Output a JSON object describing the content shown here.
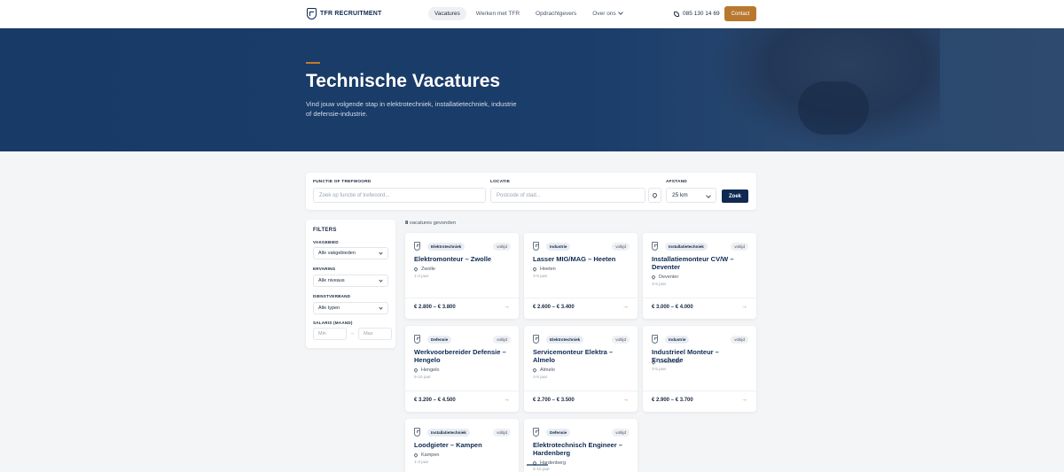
{
  "header": {
    "logo": "TFR RECRUITMENT",
    "nav": [
      {
        "label": "Vacatures",
        "active": true
      },
      {
        "label": "Werken met TFR",
        "active": false
      },
      {
        "label": "Opdrachtgevers",
        "active": false
      },
      {
        "label": "Over ons",
        "active": false
      }
    ],
    "phone": "085 130 14 69",
    "contact_label": "Contact"
  },
  "hero": {
    "title": "Technische Vacatures",
    "subtitle": "Vind jouw volgende stap in elektrotechniek, installatietechniek, industrie of defensie-industrie."
  },
  "search": {
    "keyword_label": "FUNCTIE OF TREFWOORD",
    "keyword_placeholder": "Zoek op functie of trefwoord...",
    "location_label": "LOCATIE",
    "location_placeholder": "Postcode of stad...",
    "distance_label": "AFSTAND",
    "distance_value": "25 km",
    "submit_label": "Zoek"
  },
  "filters": {
    "title": "FILTERS",
    "vakgebied_label": "VAKGEBIED",
    "vakgebied_value": "Alle vakgebieden",
    "ervaring_label": "ERVARING",
    "ervaring_value": "Alle niveaus",
    "dienstverband_label": "DIENSTVERBAND",
    "dienstverband_value": "Alle typen",
    "salaris_label": "SALARIS (MAAND)",
    "min_placeholder": "Min",
    "max_placeholder": "Max",
    "range_dash": "–"
  },
  "results": {
    "count": "8",
    "count_text": " vacatures gevonden"
  },
  "jobs": [
    {
      "tag": "Elektrotechniek",
      "type": "voltijd",
      "title": "Elektromonteur – Zwolle",
      "location": "Zwolle",
      "experience": "1-3 jaar",
      "salary": "€ 2.800 – € 3.800"
    },
    {
      "tag": "Industrie",
      "type": "voltijd",
      "title": "Lasser MIG/MAG – Heeten",
      "location": "Heeten",
      "experience": "3-5 jaar",
      "salary": "€ 2.600 – € 3.400"
    },
    {
      "tag": "Installatietechniek",
      "type": "voltijd",
      "title": "Installatiemonteur CV/W – Deventer",
      "location": "Deventer",
      "experience": "3-5 jaar",
      "salary": "€ 3.000 – € 4.000"
    },
    {
      "tag": "Defensie",
      "type": "voltijd",
      "title": "Werkvoorbereider Defensie – Hengelo",
      "location": "Hengelo",
      "experience": "5-10 jaar",
      "salary": "€ 3.200 – € 4.500"
    },
    {
      "tag": "Elektrotechniek",
      "type": "voltijd",
      "title": "Servicemonteur Elektra – Almelo",
      "location": "Almelo",
      "experience": "3-5 jaar",
      "salary": "€ 2.700 – € 3.500"
    },
    {
      "tag": "Industrie",
      "type": "voltijd",
      "title": "Industrieel Monteur – Enschede",
      "location": "Enschede",
      "experience": "3-5 jaar",
      "salary": "€ 2.900 – € 3.700"
    },
    {
      "tag": "Installatietechniek",
      "type": "voltijd",
      "title": "Loodgieter – Kampen",
      "location": "Kampen",
      "experience": "1-3 jaar",
      "salary": ""
    },
    {
      "tag": "Defensie",
      "type": "voltijd",
      "title": "Elektrotechnisch Engineer – Hardenberg",
      "location": "Hardenberg",
      "experience": "5-10 jaar",
      "salary": ""
    }
  ],
  "colors": {
    "navy": "#0e2a52",
    "accent": "#b9782f",
    "hero": "#1a3d6a"
  }
}
